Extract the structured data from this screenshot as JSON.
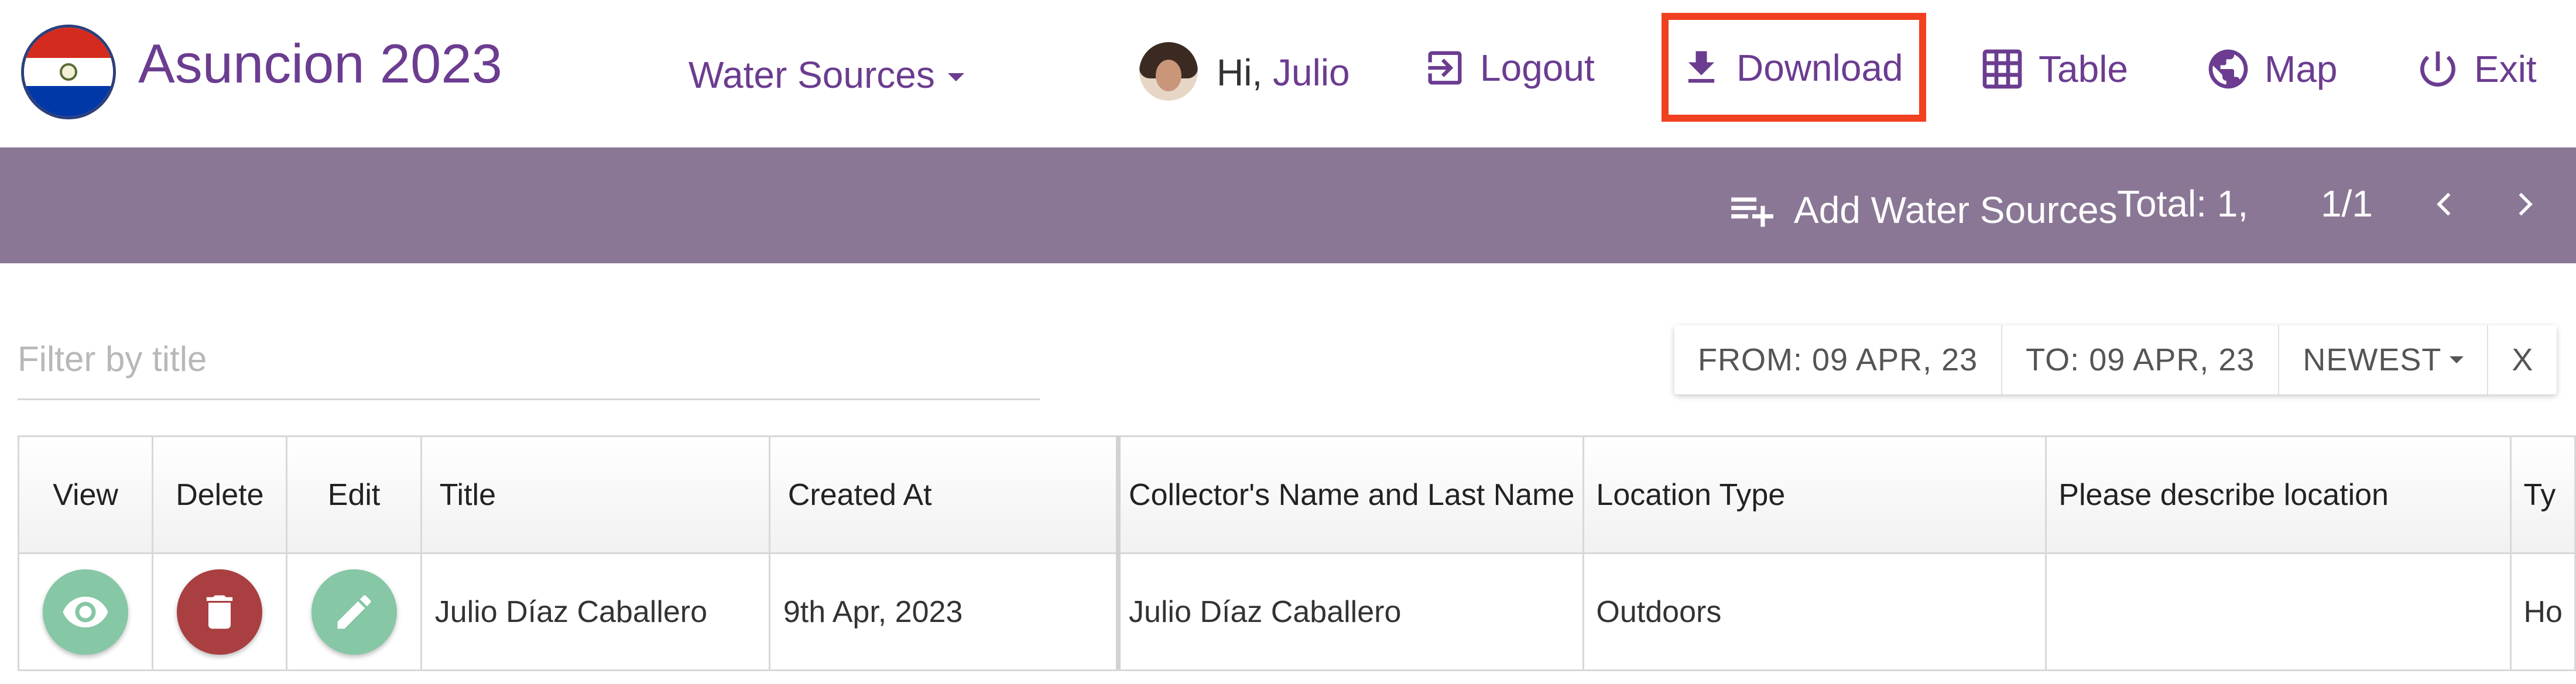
{
  "header": {
    "title": "Asuncion 2023",
    "dataset_dropdown": "Water Sources",
    "greeting_prefix": "Hi,",
    "username": "Julio",
    "nav": {
      "logout": "Logout",
      "download": "Download",
      "table": "Table",
      "map": "Map",
      "exit": "Exit"
    }
  },
  "toolbar": {
    "add_label": "Add Water Sources",
    "total": "Total: 1,",
    "pager": "1/1"
  },
  "filter": {
    "placeholder": "Filter by title",
    "value": "",
    "from": "FROM: 09 APR, 23",
    "to": "TO: 09 APR, 23",
    "sort": "NEWEST",
    "clear": "X"
  },
  "table": {
    "columns": [
      "View",
      "Delete",
      "Edit",
      "Title",
      "Created At",
      "Collector's Name and Last Name",
      "Location Type",
      "Please describe location",
      "Ty"
    ],
    "rows": [
      {
        "title": "Julio Díaz Caballero",
        "created_at": "9th Apr, 2023",
        "collector": "Julio Díaz Caballero",
        "location_type": "Outdoors",
        "describe_location": "",
        "type": "Ho"
      }
    ]
  },
  "colors": {
    "brand_purple": "#6b3c90",
    "toolbar_band": "#8a7795",
    "highlight": "#f0401f",
    "view_edit_button": "#86c7a5",
    "delete_button": "#a93f40"
  },
  "icons": {
    "logo": "paraguay-flag-icon",
    "logout": "logout-icon",
    "download": "download-icon",
    "table": "table-grid-icon",
    "map": "globe-icon",
    "exit": "power-icon",
    "add": "playlist-add-icon",
    "prev": "chevron-left-icon",
    "next": "chevron-right-icon",
    "view": "eye-icon",
    "delete": "trash-icon",
    "edit": "pencil-icon"
  }
}
